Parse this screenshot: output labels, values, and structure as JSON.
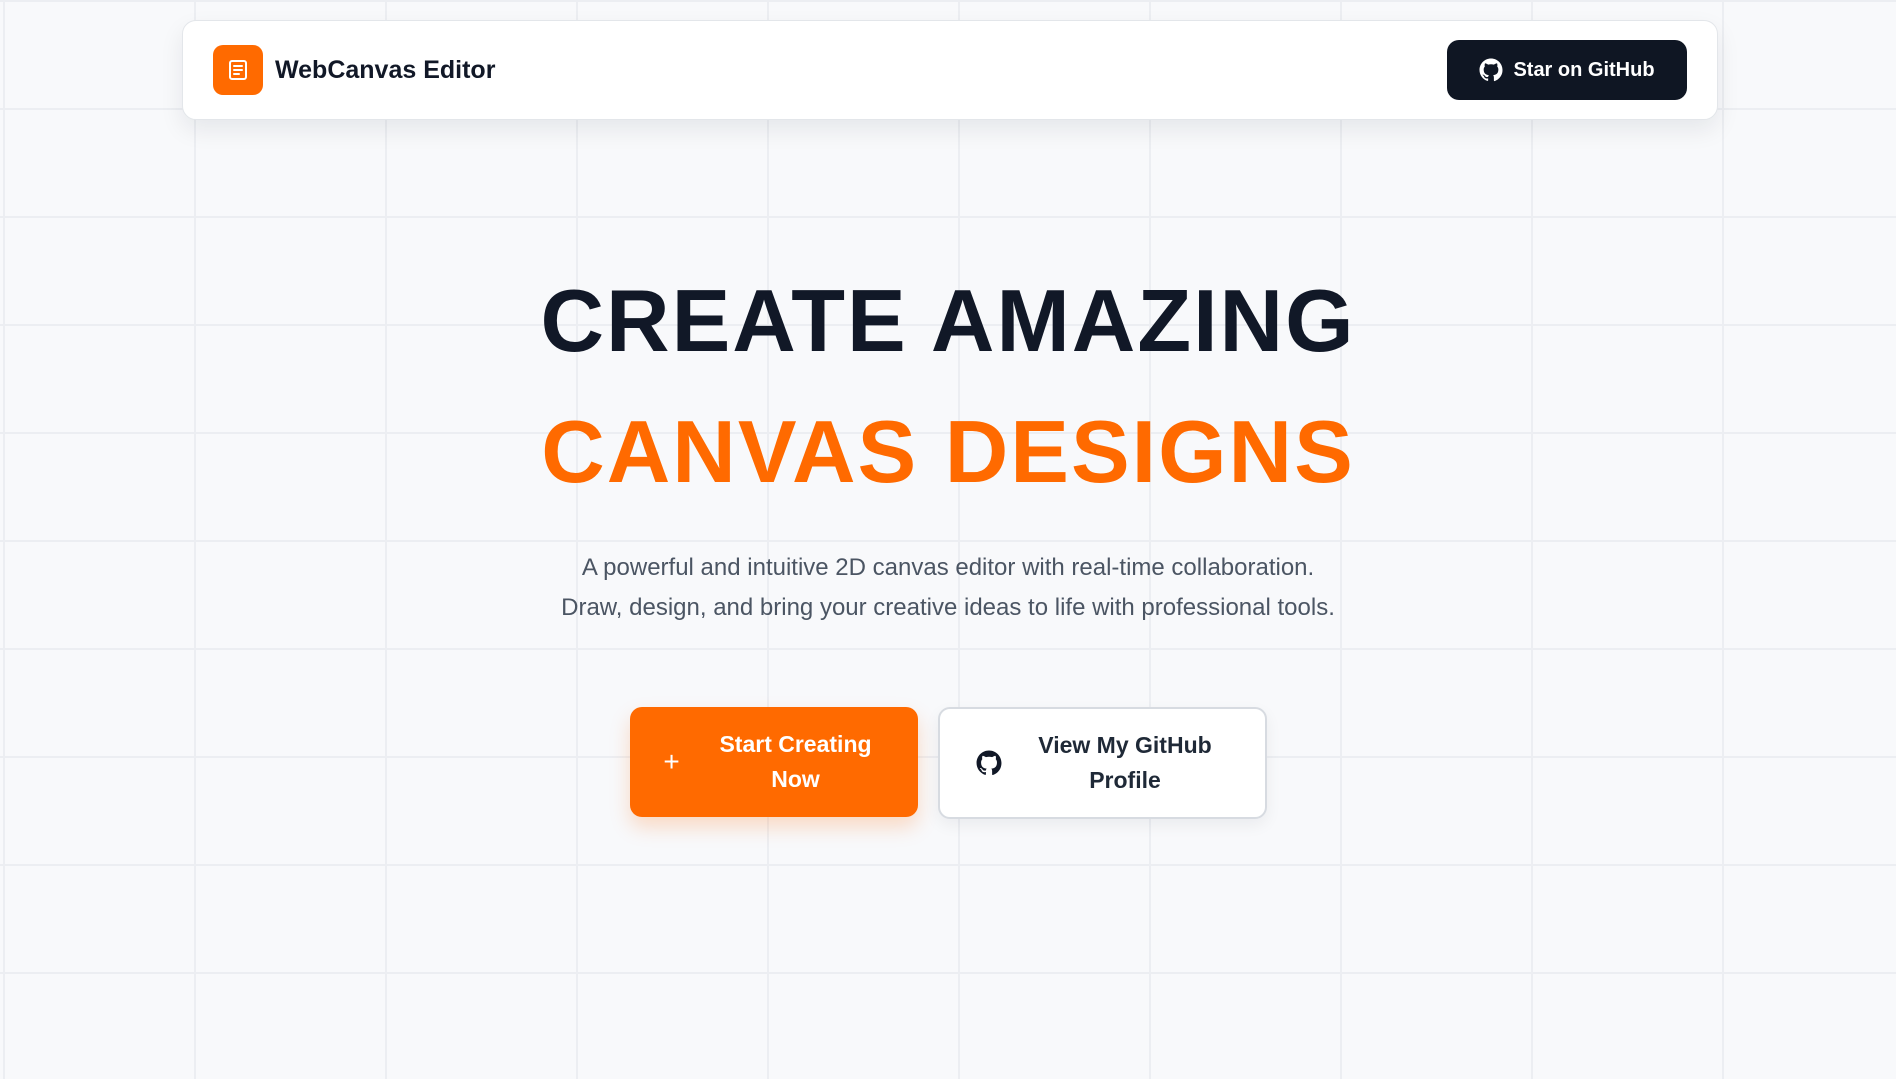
{
  "nav": {
    "brand_name": "WebCanvas Editor",
    "brand_icon": "document-icon",
    "star_button": {
      "label": "Star on GitHub",
      "icon": "github-icon"
    }
  },
  "hero": {
    "title_line1": "CREATE AMAZING",
    "title_line2": "CANVAS DESIGNS",
    "description": "A powerful and intuitive 2D canvas editor with real-time collaboration. Draw, design, and bring your creative ideas to life with professional tools."
  },
  "actions": {
    "primary": {
      "label": "Start Creating Now",
      "icon": "plus-icon",
      "icon_glyph": "+"
    },
    "secondary": {
      "label": "View My GitHub Profile",
      "icon": "github-icon"
    }
  },
  "colors": {
    "accent": "#ff6a00",
    "dark": "#0f1623",
    "text_primary": "#111827",
    "text_muted": "#4b5563",
    "background": "#f8f9fb"
  }
}
